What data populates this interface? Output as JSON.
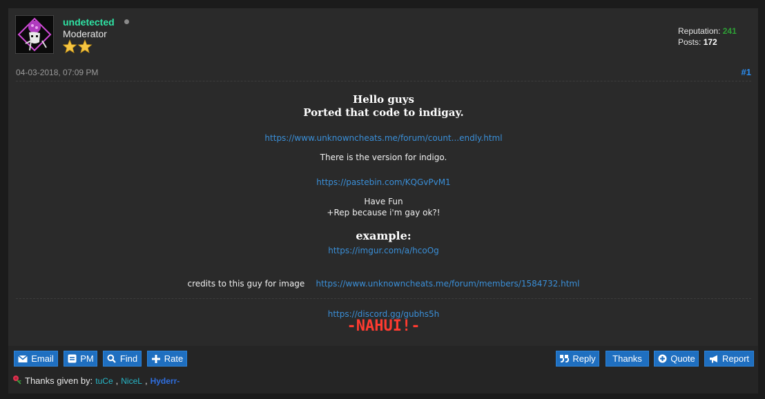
{
  "user": {
    "username": "undetected",
    "role": "Moderator",
    "reputation_label": "Reputation:",
    "reputation_value": "241",
    "posts_label": "Posts:",
    "posts_value": "172",
    "rank_stars": 2
  },
  "post": {
    "date": "04-03-2018, 07:09 PM",
    "number": "#1",
    "title_line1": "Hello guys",
    "title_line2": "Ported that code to indigay.",
    "link1": "https://www.unknowncheats.me/forum/count...endly.html",
    "text1": "There is the version for indigo.",
    "link2": "https://pastebin.com/KQGvPvM1",
    "text2": "Have Fun",
    "text3": "+Rep because i'm gay ok?!",
    "example_heading": "example:",
    "link3": "https://imgur.com/a/hcoOg",
    "credits_text": "credits to this guy for image",
    "link4": "https://www.unknowncheats.me/forum/members/1584732.html"
  },
  "signature": {
    "link": "https://discord.gg/gubhs5h",
    "tagline": "-NAHUI!-"
  },
  "actions": {
    "email": "Email",
    "pm": "PM",
    "find": "Find",
    "rate": "Rate",
    "reply": "Reply",
    "thanks": "Thanks",
    "quote": "Quote",
    "report": "Report"
  },
  "thanks": {
    "label": "Thanks given by:",
    "users": [
      "tuCe",
      "NiceL",
      "Hyderr-"
    ],
    "separator": ","
  },
  "colors": {
    "username": "#2fe3a4",
    "reputation": "#2ea036",
    "link": "#3a8fd8",
    "tagline": "#ff3b30",
    "button": "#1f6fc0"
  }
}
